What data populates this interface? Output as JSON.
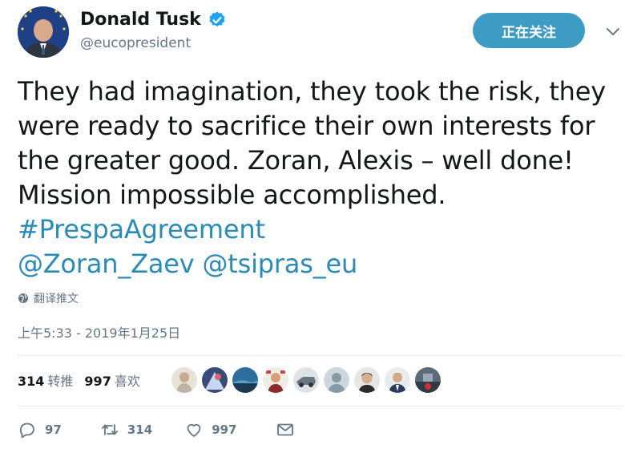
{
  "author": {
    "display_name": "Donald Tusk",
    "handle": "@eucopresident"
  },
  "follow_button": {
    "label": "正在关注"
  },
  "tweet": {
    "lines": [
      "They had imagination, they took the risk, they",
      "were ready to sacrifice their own interests for",
      "the greater good. Zoran, Alexis – well done!",
      "Mission impossible accomplished."
    ],
    "hashtag": "#PrespaAgreement",
    "mention_1": "@Zoran_Zaev",
    "mention_2": "@tsipras_eu"
  },
  "translate_label": "翻译推文",
  "timestamp": "上午5:33 - 2019年1月25日",
  "stats": {
    "retweets_count": "314",
    "retweets_label": "转推",
    "likes_count": "997",
    "likes_label": "喜欢"
  },
  "actions": {
    "reply_count": "97",
    "retweet_count": "314",
    "like_count": "997"
  },
  "colors": {
    "follow_button_bg": "#3e9bc4",
    "link": "#2a8ab8",
    "secondary_text": "#657786",
    "verified": "#1da1f2"
  }
}
